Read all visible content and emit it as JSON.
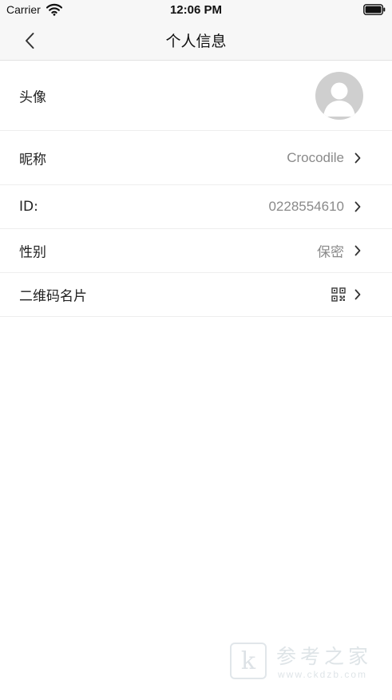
{
  "status_bar": {
    "carrier": "Carrier",
    "time": "12:06 PM"
  },
  "nav": {
    "title": "个人信息",
    "back_icon": "chevron-left-icon"
  },
  "rows": [
    {
      "label": "头像",
      "value": "",
      "type": "avatar"
    },
    {
      "label": "昵称",
      "value": "Crocodile",
      "type": "text"
    },
    {
      "label": "ID:",
      "value": "0228554610",
      "type": "text"
    },
    {
      "label": "性别",
      "value": "保密",
      "type": "text"
    },
    {
      "label": "二维码名片",
      "value": "",
      "type": "qr"
    }
  ],
  "watermark": {
    "logo_letter": "k",
    "text": "参考之家",
    "url": "www.ckdzb.com"
  },
  "colors": {
    "nav_background": "#f7f7f7",
    "value_text": "#8a8a8a",
    "label_text": "#222222",
    "divider": "#eeeeee",
    "avatar_placeholder": "#cfcfcf"
  }
}
